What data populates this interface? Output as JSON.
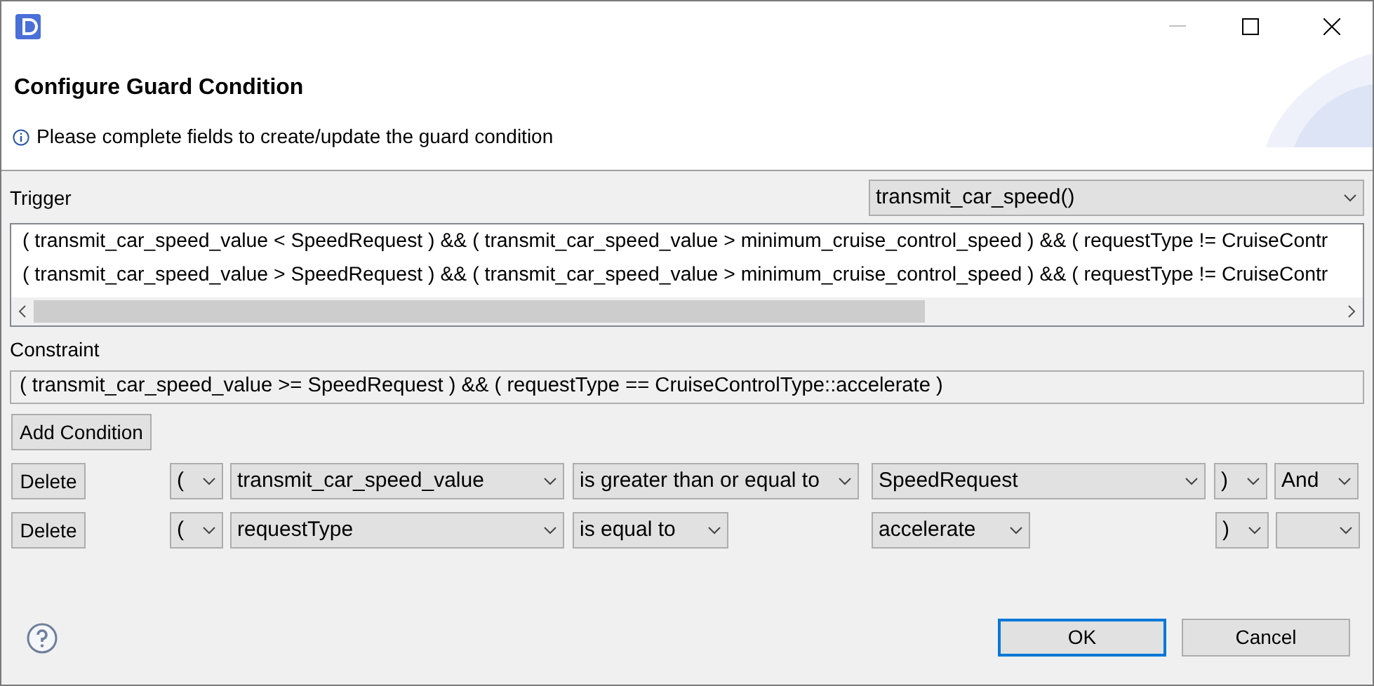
{
  "dialog": {
    "title": "Configure Guard Condition",
    "message": "Please complete fields to create/update the guard condition"
  },
  "trigger": {
    "label": "Trigger",
    "value": "transmit_car_speed()"
  },
  "existing_conditions": [
    "( transmit_car_speed_value < SpeedRequest ) && ( transmit_car_speed_value > minimum_cruise_control_speed ) && ( requestType != CruiseContr",
    "( transmit_car_speed_value > SpeedRequest ) && ( transmit_car_speed_value > minimum_cruise_control_speed ) && ( requestType != CruiseContr"
  ],
  "constraint": {
    "label": "Constraint",
    "value": "( transmit_car_speed_value >= SpeedRequest ) && ( requestType == CruiseControlType::accelerate )"
  },
  "add_button": "Add Condition",
  "conditions": [
    {
      "delete": "Delete",
      "open_paren": "(",
      "variable": "transmit_car_speed_value",
      "operator": "is greater than or equal to",
      "value": "SpeedRequest",
      "close_paren": ")",
      "connector": "And"
    },
    {
      "delete": "Delete",
      "open_paren": "(",
      "variable": "requestType",
      "operator": "is equal to",
      "value": "accelerate",
      "close_paren": ")"
    }
  ],
  "buttons": [
    {
      "label": "OK",
      "default": true
    },
    {
      "label": "Cancel",
      "default": false
    }
  ]
}
